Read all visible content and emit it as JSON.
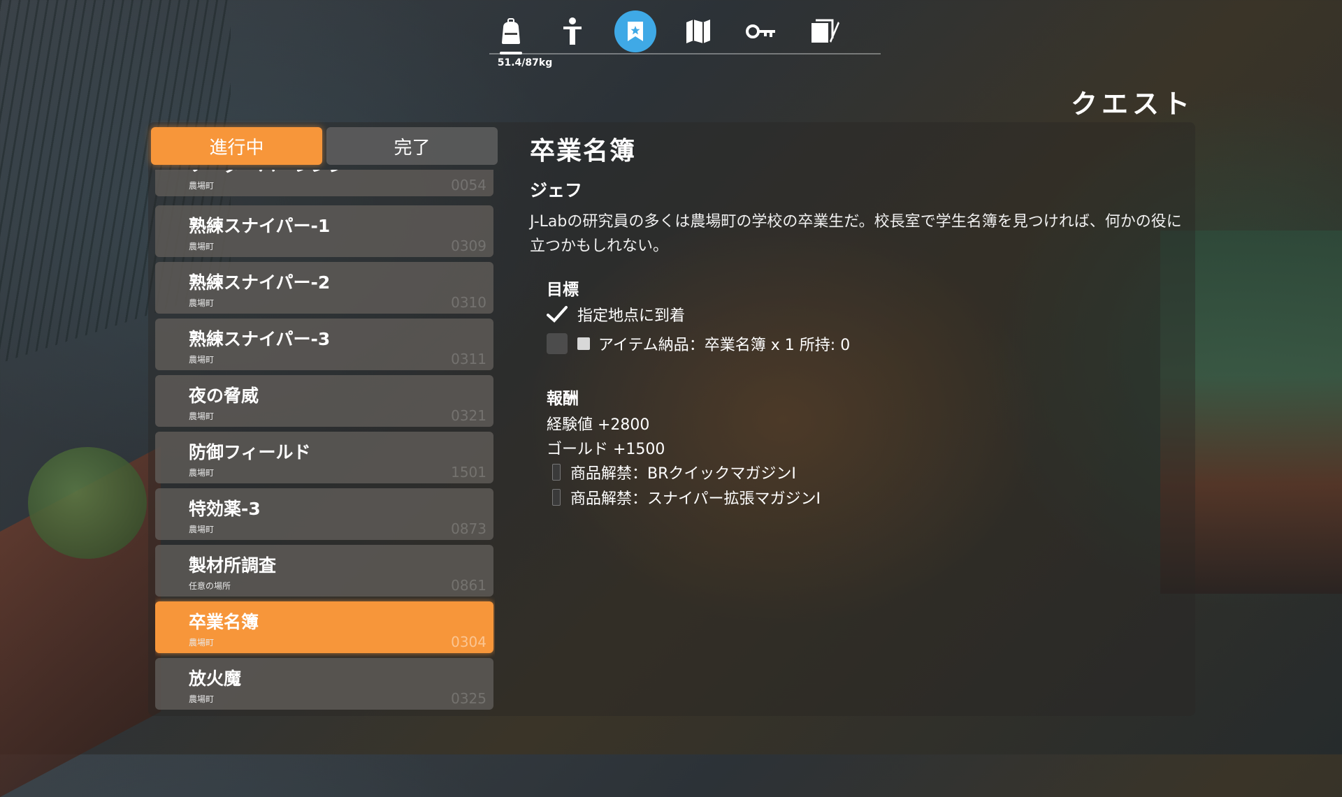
{
  "topnav": {
    "icons": [
      "backpack-icon",
      "character-icon",
      "quest-icon",
      "map-icon",
      "key-icon",
      "notes-icon"
    ],
    "weight": "51.4/87kg",
    "active_color": "#3fa9e6"
  },
  "screen_title": "クエスト",
  "tabs": {
    "in_progress": "進行中",
    "completed": "完了"
  },
  "quests": [
    {
      "name": "ソーダーパーレンシ",
      "loc": "農場町",
      "code": "0054"
    },
    {
      "name": "熟練スナイパー-1",
      "loc": "農場町",
      "code": "0309"
    },
    {
      "name": "熟練スナイパー-2",
      "loc": "農場町",
      "code": "0310"
    },
    {
      "name": "熟練スナイパー-3",
      "loc": "農場町",
      "code": "0311"
    },
    {
      "name": "夜の脅威",
      "loc": "農場町",
      "code": "0321"
    },
    {
      "name": "防御フィールド",
      "loc": "農場町",
      "code": "1501"
    },
    {
      "name": "特効薬-3",
      "loc": "農場町",
      "code": "0873"
    },
    {
      "name": "製材所調査",
      "loc": "任意の場所",
      "code": "0861"
    },
    {
      "name": "卒業名簿",
      "loc": "農場町",
      "code": "0304"
    },
    {
      "name": "放火魔",
      "loc": "農場町",
      "code": "0325"
    }
  ],
  "selected_index": 8,
  "accent_color": "#f7963a",
  "detail": {
    "title": "卒業名簿",
    "giver": "ジェフ",
    "description": "J-Labの研究員の多くは農場町の学校の卒業生だ。校長室で学生名簿を見つければ、何かの役に立つかもしれない。",
    "objectives_label": "目標",
    "objectives": [
      {
        "text": "指定地点に到着",
        "done": true
      },
      {
        "text": "アイテム納品：卒業名簿 x 1 所持: 0",
        "done": false
      }
    ],
    "rewards_label": "報酬",
    "rewards": [
      "経験値 +2800",
      "ゴールド +1500"
    ],
    "unlocks": [
      "商品解禁：BRクイックマガジンI",
      "商品解禁：スナイパー拡張マガジンI"
    ]
  }
}
